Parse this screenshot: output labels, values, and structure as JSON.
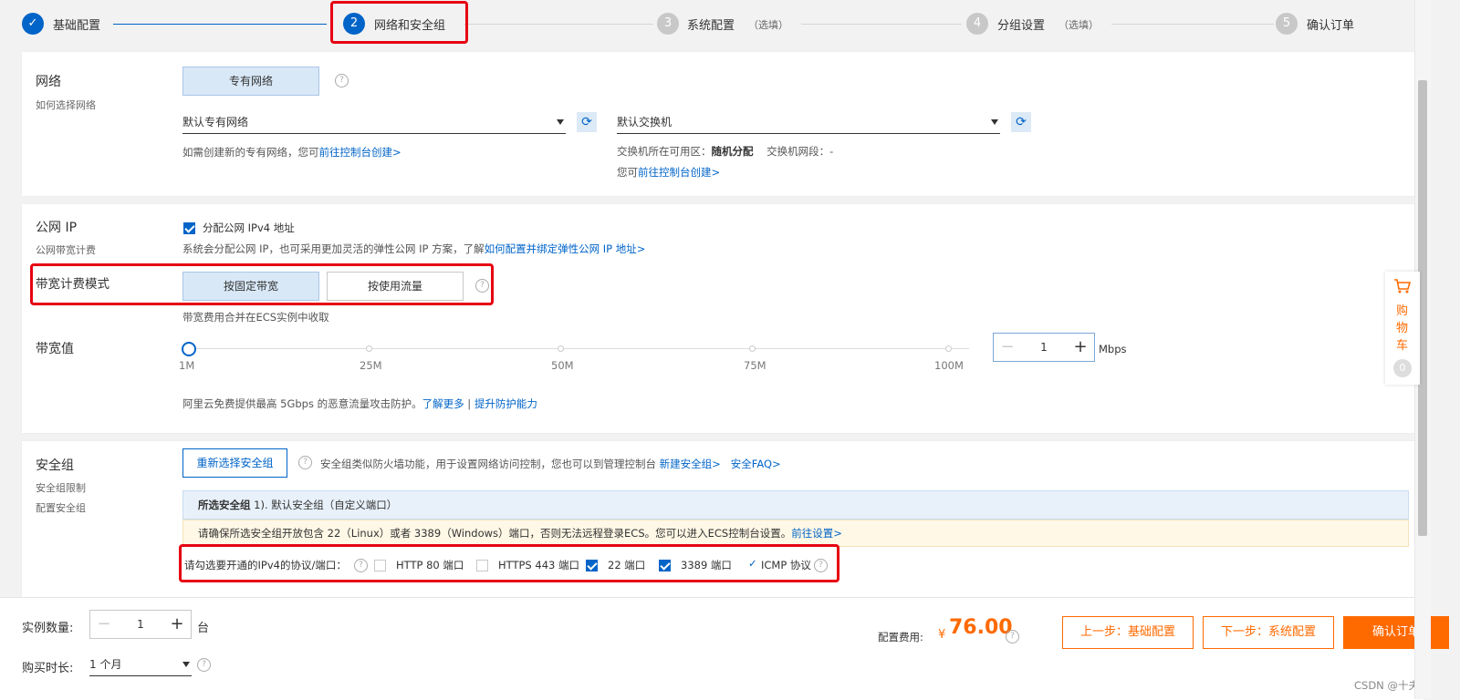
{
  "steps": [
    {
      "num": "✓",
      "label": "基础配置",
      "optional": "",
      "state": "done"
    },
    {
      "num": "2",
      "label": "网络和安全组",
      "optional": "",
      "state": "active"
    },
    {
      "num": "3",
      "label": "系统配置",
      "optional": "（选填）",
      "state": "todo"
    },
    {
      "num": "4",
      "label": "分组设置",
      "optional": "（选填）",
      "state": "todo"
    },
    {
      "num": "5",
      "label": "确认订单",
      "optional": "",
      "state": "todo"
    }
  ],
  "network": {
    "title": "网络",
    "subtitle": "如何选择网络",
    "type_button": "专有网络",
    "vpc_select": "默认专有网络",
    "vswitch_select": "默认交换机",
    "vpc_hint": "如需创建新的专有网络，您可",
    "vpc_hint_link": "前往控制台创建>",
    "zone_label": "交换机所在可用区：",
    "zone_value": "随机分配",
    "cidr_label": "交换机网段：",
    "cidr_value": "-",
    "vswitch_hint": "您可",
    "vswitch_hint_link": "前往控制台创建>"
  },
  "public_ip": {
    "title": "公网 IP",
    "subtitle": "公网带宽计费",
    "checkbox_label": "分配公网 IPv4 地址",
    "checked": true,
    "hint": "系统会分配公网 IP，也可采用更加灵活的弹性公网 IP 方案，了解",
    "hint_link": "如何配置并绑定弹性公网 IP 地址>",
    "billing_label": "带宽计费模式",
    "billing_fixed": "按固定带宽",
    "billing_traffic": "按使用流量",
    "billing_hint": "带宽费用合并在ECS实例中收取",
    "bandwidth_label": "带宽值",
    "ticks": [
      "1M",
      "25M",
      "50M",
      "75M",
      "100M"
    ],
    "bandwidth_value": "1",
    "bandwidth_unit": "Mbps",
    "ddos_hint": "阿里云免费提供最高 5Gbps 的恶意流量攻击防护。",
    "ddos_link1": "了解更多",
    "ddos_sep": "|",
    "ddos_link2": "提升防护能力"
  },
  "security_group": {
    "title": "安全组",
    "subtitle1": "安全组限制",
    "subtitle2": "配置安全组",
    "reselect_button": "重新选择安全组",
    "hint": "安全组类似防火墙功能，用于设置网络访问控制，您也可以到管理控制台",
    "link_new": "新建安全组>",
    "link_faq": "安全FAQ>",
    "selected_label": "所选安全组",
    "selected_value": "1). 默认安全组（自定义端口）",
    "warning": "请确保所选安全组开放包含 22（Linux）或者 3389（Windows）端口，否则无法远程登录ECS。您可以进入ECS控制台设置。",
    "warning_link": "前往设置>",
    "ports_label": "请勾选要开通的IPv4的协议/端口：",
    "ports": [
      {
        "label": "HTTP 80 端口",
        "checked": false
      },
      {
        "label": "HTTPS 443 端口",
        "checked": false
      },
      {
        "label": "22 端口",
        "checked": true
      },
      {
        "label": "3389 端口",
        "checked": true
      }
    ],
    "icmp_label": "ICMP 协议"
  },
  "bottom": {
    "quantity_label": "实例数量:",
    "quantity_value": "1",
    "quantity_unit": "台",
    "duration_label": "购买时长:",
    "duration_value": "1 个月",
    "fee_label": "配置费用:",
    "currency": "¥",
    "fee_value": "76.00",
    "prev_button": "上一步：基础配置",
    "next_button": "下一步：系统配置",
    "confirm_button": "确认订单",
    "watermark": "CSDN @十夫长"
  },
  "cart": {
    "label_chars": [
      "购",
      "物",
      "车"
    ],
    "count": "0"
  },
  "colors": {
    "primary": "#0064c8",
    "orange": "#ff6a00",
    "highlight": "#e60012"
  }
}
